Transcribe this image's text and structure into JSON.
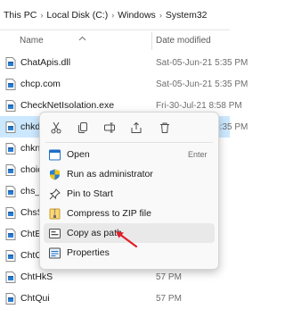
{
  "breadcrumb": {
    "items": [
      "This PC",
      "Local Disk (C:)",
      "Windows",
      "System32"
    ],
    "separator": "›"
  },
  "columns": {
    "name": "Name",
    "date_modified": "Date modified"
  },
  "files": [
    {
      "name": "ChatApis.dll",
      "date": "Sat-05-Jun-21 5:35 PM"
    },
    {
      "name": "chcp.com",
      "date": "Sat-05-Jun-21 5:35 PM"
    },
    {
      "name": "CheckNetIsolation.exe",
      "date": "Fri-30-Jul-21 8:58 PM"
    },
    {
      "name": "chkdsk.exe",
      "date": "Sat-05-Jun-21 5:35 PM"
    },
    {
      "name": "chkntfs",
      "date": "PM"
    },
    {
      "name": "choice.",
      "date": "PM"
    },
    {
      "name": "chs_sin",
      "date": "PM"
    },
    {
      "name": "ChsStro",
      "date": "57 PM"
    },
    {
      "name": "ChtBop",
      "date": "57 PM"
    },
    {
      "name": "ChtCar",
      "date": "57 PM"
    },
    {
      "name": "ChtHkS",
      "date": "57 PM"
    },
    {
      "name": "ChtQui",
      "date": "57 PM"
    }
  ],
  "context_menu": {
    "toolbar_icons": [
      "cut-icon",
      "copy-icon",
      "rename-icon",
      "share-icon",
      "delete-icon"
    ],
    "items": [
      {
        "label": "Open",
        "shortcut": "Enter",
        "icon": "open-icon"
      },
      {
        "label": "Run as administrator",
        "shortcut": "",
        "icon": "shield-icon"
      },
      {
        "label": "Pin to Start",
        "shortcut": "",
        "icon": "pin-icon"
      },
      {
        "label": "Compress to ZIP file",
        "shortcut": "",
        "icon": "zip-icon"
      },
      {
        "label": "Copy as path",
        "shortcut": "",
        "icon": "copy-path-icon"
      },
      {
        "label": "Properties",
        "shortcut": "",
        "icon": "properties-icon"
      }
    ]
  },
  "colors": {
    "selection": "#cce8ff",
    "accent": "#0067c0",
    "arrow": "#e0202a"
  }
}
